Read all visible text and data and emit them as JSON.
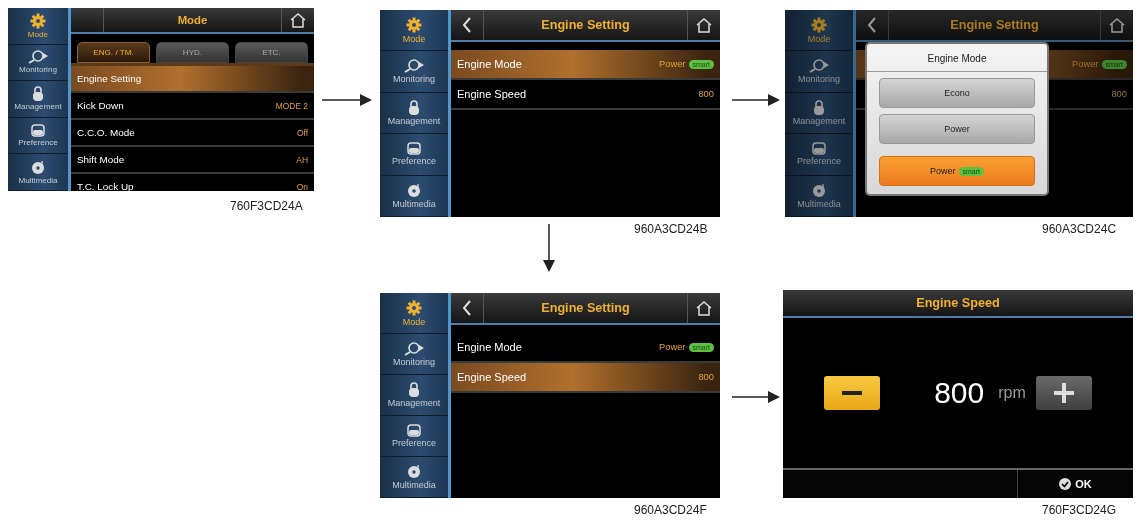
{
  "screens": [
    {
      "kind": "menu",
      "caption": "760F3CD24A",
      "back": false,
      "dimmed": false,
      "title": "Mode",
      "sidebar": [
        {
          "label": "Mode",
          "selected": true
        },
        {
          "label": "Monitoring",
          "selected": false
        },
        {
          "label": "Management",
          "selected": false
        },
        {
          "label": "Preference",
          "selected": false
        },
        {
          "label": "Multimedia",
          "selected": false
        }
      ],
      "tabs": [
        {
          "label": "ENG. / TM.",
          "selected": true
        },
        {
          "label": "HYD.",
          "selected": false
        },
        {
          "label": "ETC.",
          "selected": false
        }
      ],
      "rows": [
        {
          "label": "Engine Setting",
          "selected": true
        },
        {
          "label": "Kick Down",
          "value": "MODE 2",
          "selected": false
        },
        {
          "label": "C.C.O. Mode",
          "value": "Off",
          "selected": false
        },
        {
          "label": "Shift Mode",
          "value": "AH",
          "selected": false
        },
        {
          "label": "T.C. Lock Up",
          "value": "On",
          "selected": false
        }
      ]
    },
    {
      "kind": "menu",
      "caption": "960A3CD24B",
      "back": true,
      "dimmed": false,
      "title": "Engine Setting",
      "sidebar": [
        {
          "label": "Mode",
          "selected": true
        },
        {
          "label": "Monitoring",
          "selected": false
        },
        {
          "label": "Management",
          "selected": false
        },
        {
          "label": "Preference",
          "selected": false
        },
        {
          "label": "Multimedia",
          "selected": false
        }
      ],
      "rows": [
        {
          "label": "Engine Mode",
          "value": "Power",
          "badge": "smart",
          "selected": true
        },
        {
          "label": "Engine Speed",
          "value": "800",
          "selected": false
        }
      ]
    },
    {
      "kind": "menu",
      "caption": "960A3CD24C",
      "back": true,
      "dimmed": true,
      "title": "Engine Setting",
      "sidebar": [
        {
          "label": "Mode",
          "selected": true
        },
        {
          "label": "Monitoring",
          "selected": false
        },
        {
          "label": "Management",
          "selected": false
        },
        {
          "label": "Preference",
          "selected": false
        },
        {
          "label": "Multimedia",
          "selected": false
        }
      ],
      "rows": [
        {
          "value": "Power",
          "badge": "smart",
          "selected": true
        },
        {
          "value": "800",
          "selected": false
        }
      ],
      "dialog": {
        "title": "Engine Mode",
        "options": [
          {
            "label": "Econo",
            "selected": false
          },
          {
            "label": "Power",
            "selected": false
          },
          {
            "label": "Power",
            "badge": "smart",
            "selected": true
          }
        ]
      }
    },
    {
      "kind": "menu",
      "caption": "960A3CD24F",
      "back": true,
      "dimmed": false,
      "title": "Engine Setting",
      "sidebar": [
        {
          "label": "Mode",
          "selected": true
        },
        {
          "label": "Monitoring",
          "selected": false
        },
        {
          "label": "Management",
          "selected": false
        },
        {
          "label": "Preference",
          "selected": false
        },
        {
          "label": "Multimedia",
          "selected": false
        }
      ],
      "rows": [
        {
          "label": "Engine Mode",
          "value": "Power",
          "badge": "smart",
          "selected": false
        },
        {
          "label": "Engine Speed",
          "value": "800",
          "selected": true
        }
      ]
    },
    {
      "kind": "speed",
      "caption": "760F3CD24G",
      "title": "Engine Speed",
      "value": "800",
      "unit": "rpm",
      "ok": "OK"
    }
  ]
}
